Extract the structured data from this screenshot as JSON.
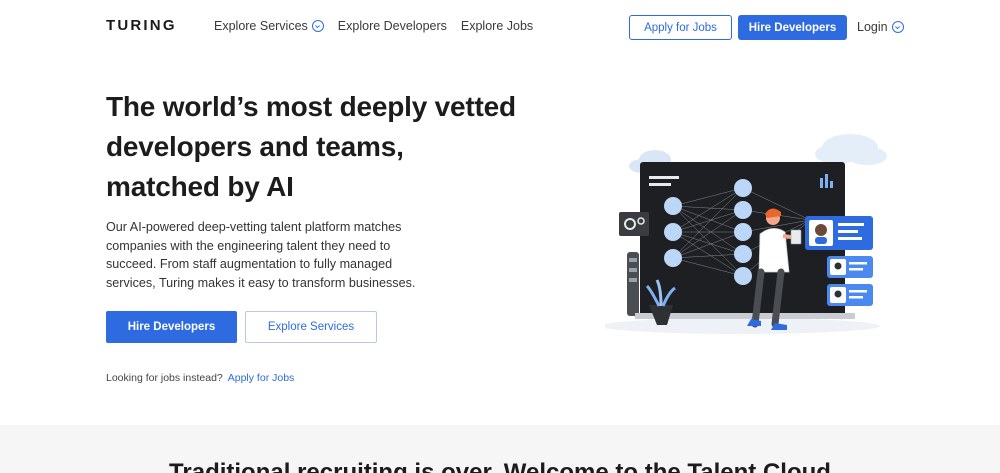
{
  "nav": {
    "logo": "TURING",
    "links": [
      {
        "label": "Explore Services",
        "has_dropdown": true
      },
      {
        "label": "Explore Developers",
        "has_dropdown": false
      },
      {
        "label": "Explore Jobs",
        "has_dropdown": false
      }
    ],
    "apply_label": "Apply for Jobs",
    "hire_label": "Hire Developers",
    "login_label": "Login"
  },
  "hero": {
    "title_line1": "The world’s most deeply vetted",
    "title_line2": "developers and teams,",
    "title_line3": "matched by AI",
    "description": "Our AI-powered deep-vetting talent platform matches companies with the engineering talent they need to succeed. From staff augmentation to fully managed services, Turing makes it easy to transform businesses.",
    "primary_cta": "Hire Developers",
    "secondary_cta": "Explore Services",
    "jobs_prompt": "Looking for jobs instead?",
    "jobs_link": "Apply for Jobs"
  },
  "next_section": {
    "title": "Traditional recruiting is over. Welcome to the Talent Cloud"
  },
  "colors": {
    "brand_blue": "#2e6be0",
    "text_dark": "#1c1c1c",
    "illustration_dark": "#1e1f22",
    "node_blue": "#bcd6f7"
  },
  "icons": [
    "chevron-down-icon",
    "gear-icon",
    "bar-chart-icon",
    "profile-card-icon",
    "cloud-icon",
    "plant-icon"
  ]
}
